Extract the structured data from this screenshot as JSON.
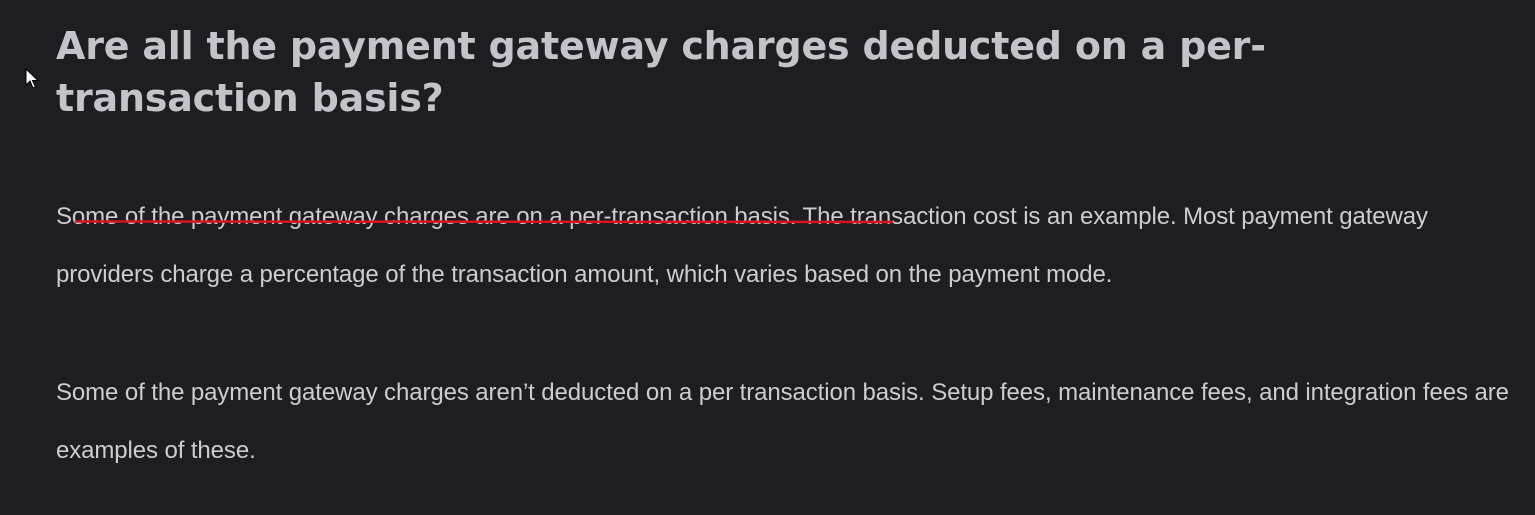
{
  "article": {
    "heading": "Are all the payment gateway charges deducted on a per-transaction basis?",
    "paragraph1": {
      "highlighted": "Some of the payment gateway charges are on a per-transaction basis.",
      "rest": " The transaction cost is an example. Most payment gateway providers charge a percentage of the transaction amount, which varies based on the payment mode."
    },
    "paragraph2": "Some of the payment gateway charges aren’t deducted on a per transaction basis. Setup fees, maintenance fees, and integration fees are examples of these."
  },
  "colors": {
    "background": "#1e1d22",
    "heading_text": "#c4c3c9",
    "body_text": "#cdcccf",
    "annotation_underline": "#d9141c"
  },
  "icons": {
    "cursor": "mouse-pointer-icon"
  }
}
